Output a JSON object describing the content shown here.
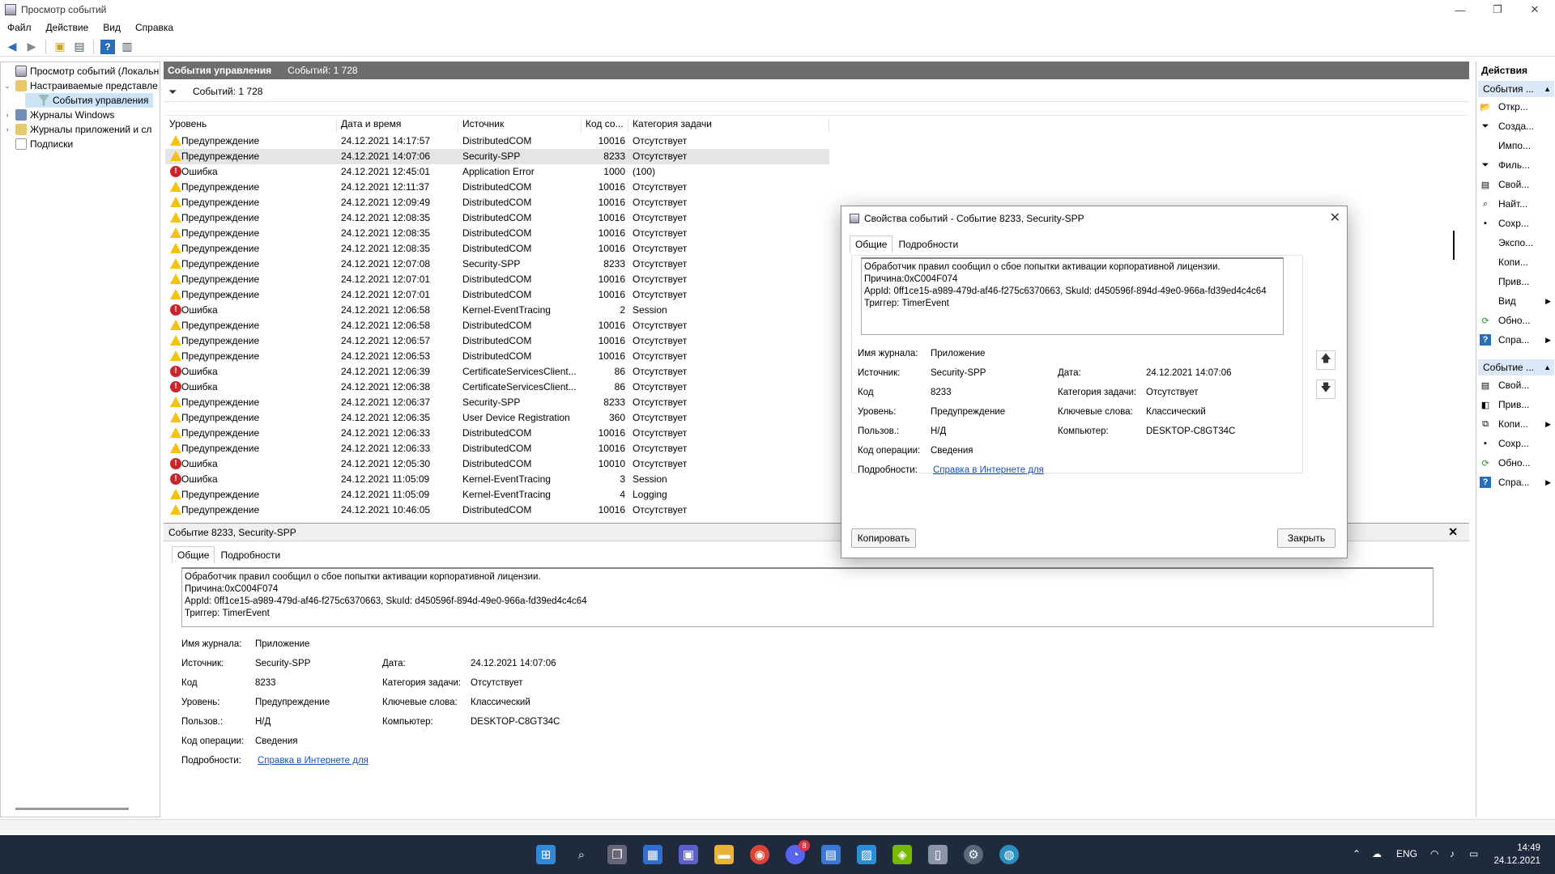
{
  "window": {
    "title": "Просмотр событий",
    "controls": [
      "—",
      "❐",
      "✕"
    ]
  },
  "menu": [
    "Файл",
    "Действие",
    "Вид",
    "Справка"
  ],
  "tree": [
    {
      "label": "Просмотр событий (Локальны",
      "expand": ""
    },
    {
      "label": "Настраиваемые представле",
      "expand": "⌄"
    },
    {
      "label": "События управления",
      "expand": ""
    },
    {
      "label": "Журналы Windows",
      "expand": "›"
    },
    {
      "label": "Журналы приложений и сл",
      "expand": "›"
    },
    {
      "label": "Подписки",
      "expand": ""
    }
  ],
  "pane_header": {
    "title": "События управления",
    "count": "Событий: 1 728"
  },
  "filter_text": "Событий: 1 728",
  "columns": [
    "Уровень",
    "Дата и время",
    "Источник",
    "Код со...",
    "Категория задачи"
  ],
  "rows": [
    {
      "level": "Предупреждение",
      "type": "warn",
      "date": "24.12.2021 14:17:57",
      "source": "DistributedCOM",
      "code": "10016",
      "cat": "Отсутствует"
    },
    {
      "level": "Предупреждение",
      "type": "warn",
      "date": "24.12.2021 14:07:06",
      "source": "Security-SPP",
      "code": "8233",
      "cat": "Отсутствует",
      "selected": true
    },
    {
      "level": "Ошибка",
      "type": "err",
      "date": "24.12.2021 12:45:01",
      "source": "Application Error",
      "code": "1000",
      "cat": "(100)"
    },
    {
      "level": "Предупреждение",
      "type": "warn",
      "date": "24.12.2021 12:11:37",
      "source": "DistributedCOM",
      "code": "10016",
      "cat": "Отсутствует"
    },
    {
      "level": "Предупреждение",
      "type": "warn",
      "date": "24.12.2021 12:09:49",
      "source": "DistributedCOM",
      "code": "10016",
      "cat": "Отсутствует"
    },
    {
      "level": "Предупреждение",
      "type": "warn",
      "date": "24.12.2021 12:08:35",
      "source": "DistributedCOM",
      "code": "10016",
      "cat": "Отсутствует"
    },
    {
      "level": "Предупреждение",
      "type": "warn",
      "date": "24.12.2021 12:08:35",
      "source": "DistributedCOM",
      "code": "10016",
      "cat": "Отсутствует"
    },
    {
      "level": "Предупреждение",
      "type": "warn",
      "date": "24.12.2021 12:08:35",
      "source": "DistributedCOM",
      "code": "10016",
      "cat": "Отсутствует"
    },
    {
      "level": "Предупреждение",
      "type": "warn",
      "date": "24.12.2021 12:07:08",
      "source": "Security-SPP",
      "code": "8233",
      "cat": "Отсутствует"
    },
    {
      "level": "Предупреждение",
      "type": "warn",
      "date": "24.12.2021 12:07:01",
      "source": "DistributedCOM",
      "code": "10016",
      "cat": "Отсутствует"
    },
    {
      "level": "Предупреждение",
      "type": "warn",
      "date": "24.12.2021 12:07:01",
      "source": "DistributedCOM",
      "code": "10016",
      "cat": "Отсутствует"
    },
    {
      "level": "Ошибка",
      "type": "err",
      "date": "24.12.2021 12:06:58",
      "source": "Kernel-EventTracing",
      "code": "2",
      "cat": "Session"
    },
    {
      "level": "Предупреждение",
      "type": "warn",
      "date": "24.12.2021 12:06:58",
      "source": "DistributedCOM",
      "code": "10016",
      "cat": "Отсутствует"
    },
    {
      "level": "Предупреждение",
      "type": "warn",
      "date": "24.12.2021 12:06:57",
      "source": "DistributedCOM",
      "code": "10016",
      "cat": "Отсутствует"
    },
    {
      "level": "Предупреждение",
      "type": "warn",
      "date": "24.12.2021 12:06:53",
      "source": "DistributedCOM",
      "code": "10016",
      "cat": "Отсутствует"
    },
    {
      "level": "Ошибка",
      "type": "err",
      "date": "24.12.2021 12:06:39",
      "source": "CertificateServicesClient...",
      "code": "86",
      "cat": "Отсутствует"
    },
    {
      "level": "Ошибка",
      "type": "err",
      "date": "24.12.2021 12:06:38",
      "source": "CertificateServicesClient...",
      "code": "86",
      "cat": "Отсутствует"
    },
    {
      "level": "Предупреждение",
      "type": "warn",
      "date": "24.12.2021 12:06:37",
      "source": "Security-SPP",
      "code": "8233",
      "cat": "Отсутствует"
    },
    {
      "level": "Предупреждение",
      "type": "warn",
      "date": "24.12.2021 12:06:35",
      "source": "User Device Registration",
      "code": "360",
      "cat": "Отсутствует"
    },
    {
      "level": "Предупреждение",
      "type": "warn",
      "date": "24.12.2021 12:06:33",
      "source": "DistributedCOM",
      "code": "10016",
      "cat": "Отсутствует"
    },
    {
      "level": "Предупреждение",
      "type": "warn",
      "date": "24.12.2021 12:06:33",
      "source": "DistributedCOM",
      "code": "10016",
      "cat": "Отсутствует"
    },
    {
      "level": "Ошибка",
      "type": "err",
      "date": "24.12.2021 12:05:30",
      "source": "DistributedCOM",
      "code": "10010",
      "cat": "Отсутствует"
    },
    {
      "level": "Ошибка",
      "type": "err",
      "date": "24.12.2021 11:05:09",
      "source": "Kernel-EventTracing",
      "code": "3",
      "cat": "Session"
    },
    {
      "level": "Предупреждение",
      "type": "warn",
      "date": "24.12.2021 11:05:09",
      "source": "Kernel-EventTracing",
      "code": "4",
      "cat": "Logging"
    },
    {
      "level": "Предупреждение",
      "type": "warn",
      "date": "24.12.2021 10:46:05",
      "source": "DistributedCOM",
      "code": "10016",
      "cat": "Отсутствует"
    }
  ],
  "detail": {
    "header": "Событие 8233, Security-SPP",
    "tabs": [
      "Общие",
      "Подробности"
    ],
    "message": "Обработчик правил сообщил о сбое попытки активации корпоративной лицензии.\nПричина:0xC004F074\nAppId: 0ff1ce15-a989-479d-af46-f275c6370663, SkuId: d450596f-894d-49e0-966a-fd39ed4c4c64\nТриггер: TimerEvent",
    "labels": {
      "log": "Имя журнала:",
      "source": "Источник:",
      "code": "Код",
      "level": "Уровень:",
      "user": "Пользов.:",
      "opcode": "Код операции:",
      "more": "Подробности:",
      "date": "Дата:",
      "task": "Категория задачи:",
      "keywords": "Ключевые слова:",
      "computer": "Компьютер:"
    },
    "values": {
      "log": "Приложение",
      "source": "Security-SPP",
      "code": "8233",
      "level": "Предупреждение",
      "user": "Н/Д",
      "opcode": "Сведения",
      "more": "Справка в Интернете для ",
      "date": "24.12.2021 14:07:06",
      "task": "Отсутствует",
      "keywords": "Классический",
      "computer": "DESKTOP-C8GT34C"
    }
  },
  "dialog": {
    "title": "Свойства событий - Событие 8233, Security-SPP",
    "copy_button": "Копировать",
    "close_button": "Закрыть"
  },
  "actions": {
    "header": "Действия",
    "section1": "События ...",
    "items1": [
      {
        "label": "Откр...",
        "icon": "open-icon",
        "arrow": ""
      },
      {
        "label": "Созда...",
        "icon": "filter-create-icon",
        "arrow": ""
      },
      {
        "label": "Импо...",
        "icon": "",
        "arrow": ""
      },
      {
        "label": "Филь...",
        "icon": "filter-icon",
        "arrow": ""
      },
      {
        "label": "Свой...",
        "icon": "properties-icon",
        "arrow": ""
      },
      {
        "label": "Найт...",
        "icon": "find-icon",
        "arrow": ""
      },
      {
        "label": "Сохр...",
        "icon": "save-icon",
        "arrow": ""
      },
      {
        "label": "Экспо...",
        "icon": "",
        "arrow": ""
      },
      {
        "label": "Копи...",
        "icon": "",
        "arrow": ""
      },
      {
        "label": "Прив...",
        "icon": "",
        "arrow": ""
      },
      {
        "label": "Вид",
        "icon": "",
        "arrow": "▶"
      },
      {
        "label": "Обно...",
        "icon": "refresh-icon",
        "arrow": ""
      },
      {
        "label": "Спра...",
        "icon": "help-icon",
        "arrow": "▶"
      }
    ],
    "section2": "Событие ...",
    "items2": [
      {
        "label": "Свой...",
        "icon": "properties-icon",
        "arrow": ""
      },
      {
        "label": "Прив...",
        "icon": "attach-task-icon",
        "arrow": ""
      },
      {
        "label": "Копи...",
        "icon": "copy-icon",
        "arrow": "▶"
      },
      {
        "label": "Сохр...",
        "icon": "save-icon",
        "arrow": ""
      },
      {
        "label": "Обно...",
        "icon": "refresh-icon",
        "arrow": ""
      },
      {
        "label": "Спра...",
        "icon": "help-icon",
        "arrow": "▶"
      }
    ]
  },
  "taskbar": {
    "lang": "ENG",
    "time": "14:49",
    "date": "24.12.2021",
    "badge": "8"
  },
  "colors": {
    "accent": "#2a6ebb",
    "header": "#6d6d6d",
    "warn": "#f5c211",
    "err": "#c8262c",
    "taskbar": "#1f2b3d"
  }
}
